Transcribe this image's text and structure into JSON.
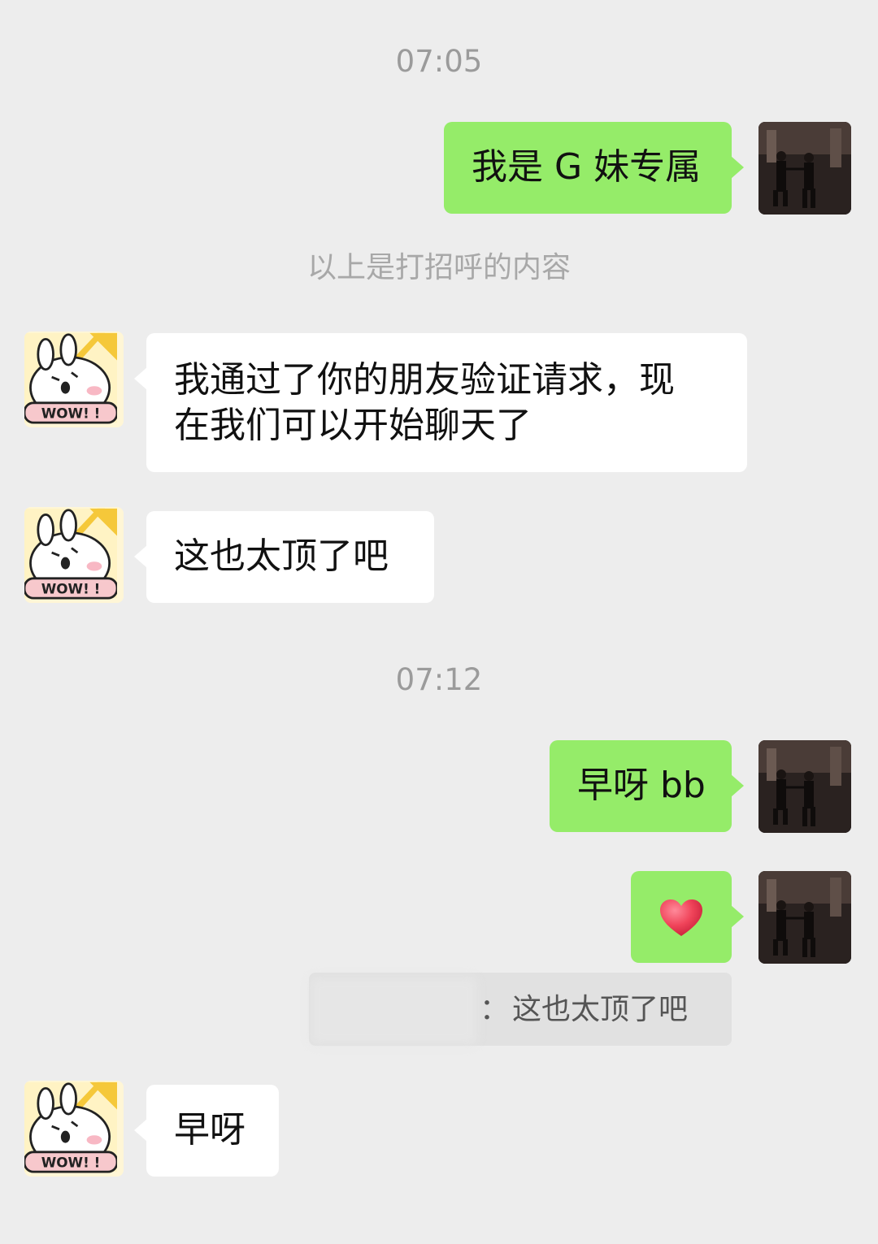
{
  "timestamps": [
    "07:05",
    "07:12"
  ],
  "system_message": "以上是打招呼的内容",
  "messages": [
    {
      "side": "right",
      "text": "我是 G 妹专属"
    },
    {
      "side": "left",
      "text_line1": "我通过了你的朋友验证请求，现",
      "text_line2": "在我们可以开始聊天了"
    },
    {
      "side": "left",
      "text": "这也太顶了吧"
    },
    {
      "side": "right",
      "text": "早呀 bb"
    },
    {
      "side": "right",
      "emoji": "heart-icon"
    },
    {
      "side": "left",
      "text": "早呀"
    }
  ],
  "quote": {
    "separator": "：",
    "text": "这也太顶了吧"
  },
  "avatar_other_label": "WOW! !",
  "colors": {
    "background": "#ededed",
    "my_bubble": "#95ec69",
    "other_bubble": "#ffffff",
    "heart": "#f0445a"
  }
}
